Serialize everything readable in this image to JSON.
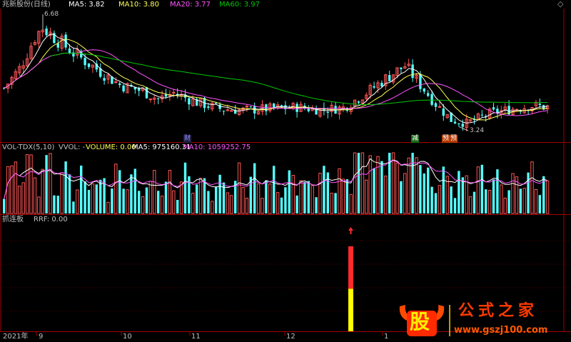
{
  "colors": {
    "up": "#ff5555",
    "down": "#54ffff",
    "ma5": "#ffffff",
    "ma10": "#ffff54",
    "ma20": "#ff54ff",
    "ma60": "#00c800",
    "axis": "#a00000",
    "text": "#c0c0c0",
    "arrow_red": "#ff2a2a",
    "bar_yellow": "#ffff00"
  },
  "price_panel": {
    "title": "兆新股份(日线)",
    "ma5": "MA5: 3.82",
    "ma10": "MA10: 3.80",
    "ma20": "MA20: 3.77",
    "ma60": "MA60: 3.97",
    "high_label": "6.68",
    "low_label": "3.24",
    "stamps": [
      "财",
      "减",
      "预",
      "预"
    ],
    "settings_icon": "diamond-settings-icon"
  },
  "volume_panel": {
    "title": "VOL-TDX(5,10)",
    "vvol": "VVOL: -",
    "volume": "VOLUME: 0.00",
    "ma5": "MA5: 975160.31",
    "ma10": "MA10: 1059252.75"
  },
  "indicator_panel": {
    "title": "抓连板",
    "rrf": "RRF: 0.00",
    "signal": {
      "red_fraction": 0.5,
      "yellow_fraction": 0.5
    }
  },
  "x_axis": {
    "labels": [
      "2021年",
      "9",
      "10",
      "11",
      "12",
      "1"
    ]
  },
  "watermark": {
    "stock_char": "股",
    "site_name": "公式之家",
    "url": "www.gszj100.com"
  }
}
